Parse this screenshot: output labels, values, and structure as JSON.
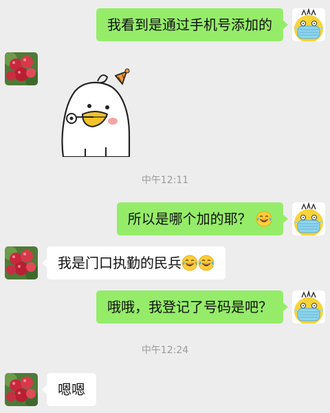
{
  "messages": [
    {
      "side": "right",
      "text": "我看到是通过手机号添加的"
    },
    {
      "side": "left",
      "type": "sticker",
      "sticker": "party-duck-sticker"
    },
    {
      "side": "right",
      "text": "所以是哪个加的耶？",
      "emoji": "laughing-tears"
    },
    {
      "side": "left",
      "text": "我是门口执勤的民兵",
      "emoji": "laughing-tears",
      "emoji_count": 2
    },
    {
      "side": "right",
      "text": "哦哦，我登记了号码是吧？"
    },
    {
      "side": "left",
      "text": "嗯嗯"
    }
  ],
  "timestamps": [
    "中午12:11",
    "中午12:24"
  ],
  "avatars": {
    "me": "masked-yellow-duck-avatar",
    "other": "lychee-fruit-avatar"
  },
  "colors": {
    "background": "#ededed",
    "my_bubble": "#95ec69",
    "their_bubble": "#ffffff",
    "timestamp": "#9a9a9a"
  }
}
